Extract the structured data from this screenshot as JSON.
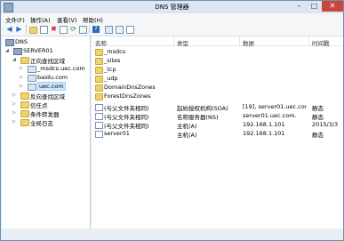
{
  "window": {
    "title": "DNS 管理器"
  },
  "menu": [
    "文件(F)",
    "操作(A)",
    "查看(V)",
    "帮助(H)"
  ],
  "toolbar_icons": [
    "back-arrow-icon",
    "forward-arrow-icon",
    "folder-up-icon",
    "console-tree-icon",
    "delete-icon",
    "properties-icon",
    "refresh-icon",
    "export-icon",
    "help-icon",
    "server-icon",
    "zone-icon",
    "record-icon"
  ],
  "tree": {
    "root": "DNS",
    "server": "SERVER01",
    "forward": "正向查找区域",
    "zones": [
      "_msdcs.uec.com",
      "baidu.com",
      "uec.com"
    ],
    "reverse": "反向查找区域",
    "trust": "信任点",
    "conditional": "条件转发器",
    "log": "全局日志"
  },
  "columns": [
    "名称",
    "类型",
    "数据",
    "时间戳"
  ],
  "rows": [
    {
      "name": "_msdcs",
      "type": "",
      "data": "",
      "time": "",
      "kind": "folder"
    },
    {
      "name": "_sites",
      "type": "",
      "data": "",
      "time": "",
      "kind": "folder"
    },
    {
      "name": "_tcp",
      "type": "",
      "data": "",
      "time": "",
      "kind": "folder"
    },
    {
      "name": "_udp",
      "type": "",
      "data": "",
      "time": "",
      "kind": "folder"
    },
    {
      "name": "DomainDnsZones",
      "type": "",
      "data": "",
      "time": "",
      "kind": "folder"
    },
    {
      "name": "ForestDnsZones",
      "type": "",
      "data": "",
      "time": "",
      "kind": "folder"
    },
    {
      "name": "(与父文件夹相同)",
      "type": "起始授权机构(SOA)",
      "data": "[19], server01.uec.com., ...",
      "time": "静态",
      "kind": "record"
    },
    {
      "name": "(与父文件夹相同)",
      "type": "名称服务器(NS)",
      "data": "server01.uec.com.",
      "time": "静态",
      "kind": "record"
    },
    {
      "name": "(与父文件夹相同)",
      "type": "主机(A)",
      "data": "192.168.1.101",
      "time": "2015/3/3",
      "kind": "record"
    },
    {
      "name": "server01",
      "type": "主机(A)",
      "data": "192.168.1.101",
      "time": "静态",
      "kind": "record"
    }
  ]
}
